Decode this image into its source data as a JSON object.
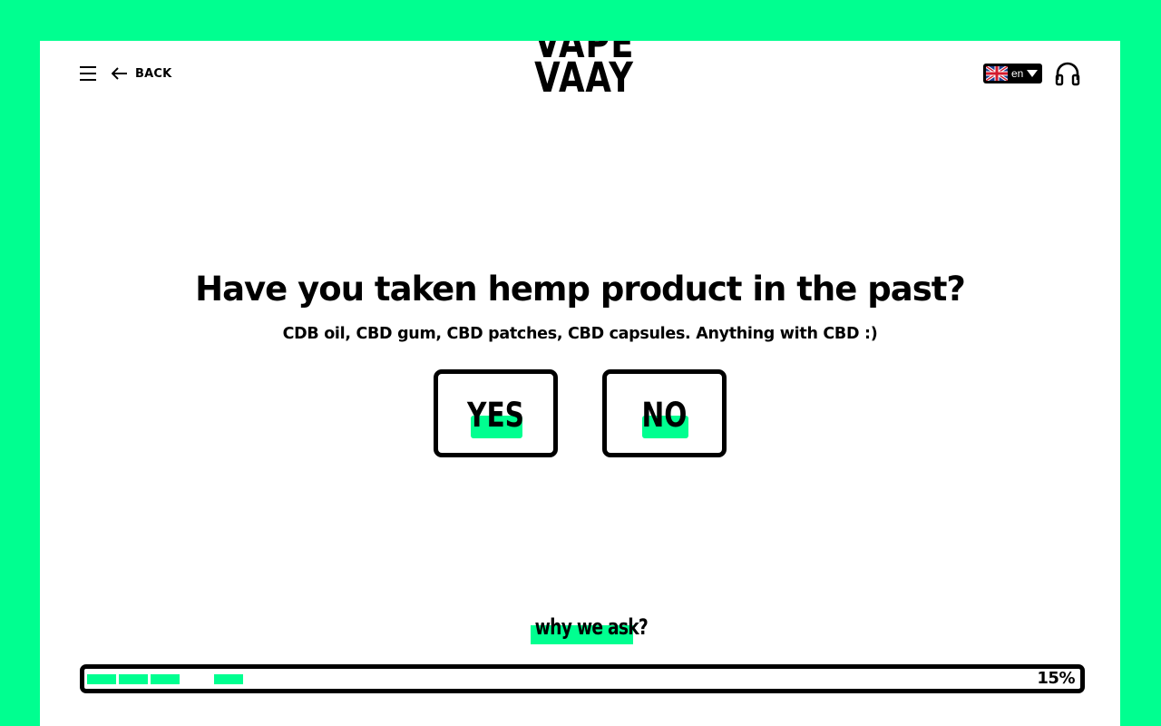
{
  "header": {
    "back_label": "BACK",
    "logo_lines": [
      "VAPE",
      "VAAY"
    ],
    "language": {
      "selected": "en",
      "flag": "uk-flag-icon"
    },
    "support_icon": "headphones-icon",
    "menu_icon": "hamburger-icon",
    "back_icon": "arrow-left-icon"
  },
  "question": {
    "title": "Have you taken hemp product in the past?",
    "subtitle": "CDB oil, CBD gum, CBD patches, CBD capsules. Anything with CBD :)",
    "answers": [
      {
        "label": "YES"
      },
      {
        "label": "NO"
      }
    ]
  },
  "why_link": "why we ask?",
  "progress": {
    "percent_label": "15%",
    "value": 0.15,
    "filled_segments": [
      1,
      2,
      3,
      5
    ]
  },
  "colors": {
    "accent": "#00ff90",
    "text": "#000000",
    "panel": "#ffffff"
  }
}
